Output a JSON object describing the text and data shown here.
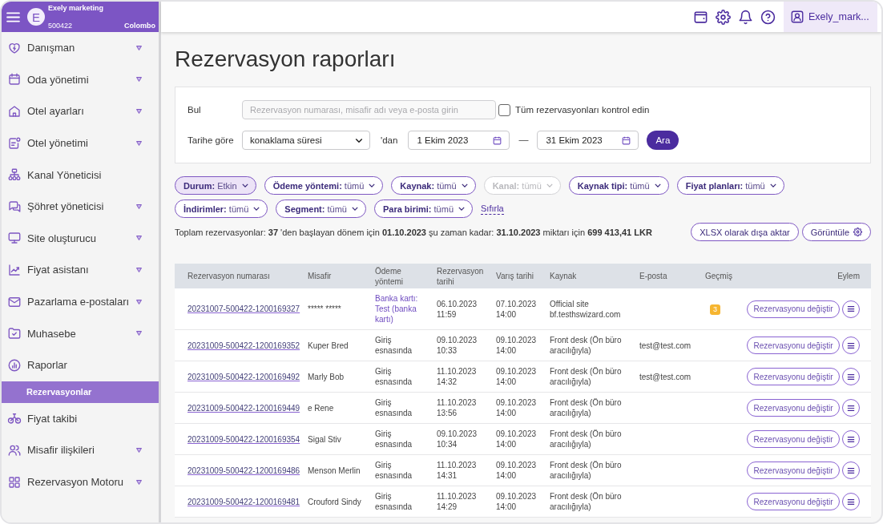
{
  "sidebar": {
    "header": {
      "avatar_letter": "E",
      "org_name": "Exely marketing",
      "org_id": "500422",
      "city": "Colombo"
    },
    "items": [
      {
        "label": "Danışman",
        "has_submenu": true,
        "selected": false
      },
      {
        "label": "Oda yönetimi",
        "has_submenu": true,
        "selected": false
      },
      {
        "label": "Otel ayarları",
        "has_submenu": true,
        "selected": false
      },
      {
        "label": "Otel yönetimi",
        "has_submenu": true,
        "selected": false
      },
      {
        "label": "Kanal Yöneticisi",
        "has_submenu": false,
        "selected": false
      },
      {
        "label": "Şöhret yöneticisi",
        "has_submenu": true,
        "selected": false
      },
      {
        "label": "Site oluşturucu",
        "has_submenu": true,
        "selected": false
      },
      {
        "label": "Fiyat asistanı",
        "has_submenu": true,
        "selected": false
      },
      {
        "label": "Pazarlama e-postaları",
        "has_submenu": true,
        "selected": false
      },
      {
        "label": "Muhasebe",
        "has_submenu": true,
        "selected": false
      },
      {
        "label": "Raporlar",
        "has_submenu": false,
        "selected": false,
        "children": [
          {
            "label": "Rezervasyonlar",
            "selected": true
          }
        ]
      },
      {
        "label": "Fiyat takibi",
        "has_submenu": false,
        "selected": false
      },
      {
        "label": "Misafir ilişkileri",
        "has_submenu": true,
        "selected": false
      },
      {
        "label": "Rezervasyon Motoru",
        "has_submenu": true,
        "selected": false
      }
    ]
  },
  "top_bar": {
    "user": "Exely_mark..."
  },
  "title": "Rezervasyon raporları",
  "search_panel": {
    "find_label": "Bul",
    "search": {
      "placeholder": "Rezervasyon numarası, misafir adı veya e-posta girin"
    },
    "check_all": {
      "label": "Tüm rezervasyonları kontrol edin",
      "checked": false
    },
    "date_label": "Tarihe göre",
    "date_type": "konaklama süresi",
    "from_suffix": "'dan",
    "date_from": "1 Ekim 2023",
    "range_dash": "—",
    "date_to": "31 Ekim 2023",
    "search_button": "Ara"
  },
  "filters": [
    {
      "label": "Durum:",
      "value": "Etkin",
      "selected": true,
      "disabled": false
    },
    {
      "label": "Ödeme yöntemi:",
      "value": "tümü",
      "selected": false,
      "disabled": false
    },
    {
      "label": "Kaynak:",
      "value": "tümü",
      "selected": false,
      "disabled": false
    },
    {
      "label": "Kanal:",
      "value": "tümü",
      "selected": false,
      "disabled": true
    },
    {
      "label": "Kaynak tipi:",
      "value": "tümü",
      "selected": false,
      "disabled": false
    },
    {
      "label": "Fiyat planları:",
      "value": "tümü",
      "selected": false,
      "disabled": false
    },
    {
      "label": "İndirimler:",
      "value": "tümü",
      "selected": false,
      "disabled": false
    },
    {
      "label": "Segment:",
      "value": "tümü",
      "selected": false,
      "disabled": false
    },
    {
      "label": "Para birimi:",
      "value": "tümü",
      "selected": false,
      "disabled": false
    }
  ],
  "reset_link": "Sıfırla",
  "summary": "Toplam rezervasyonlar: **37** 'den başlayan dönem için **01.10.2023** şu zaman kadar: **31.10.2023** miktarı için **699 413,41 LKR**",
  "export_button": "XLSX olarak dışa aktar",
  "view_button": "Görüntüle",
  "table": {
    "columns": [
      "Rezervasyon numarası",
      "Misafir",
      "Ödeme yöntemi",
      "Rezervasyon tarihi",
      "Varış tarihi",
      "Kaynak",
      "E-posta",
      "Geçmiş",
      "Eylem"
    ],
    "rows": [
      {
        "number": "20231007-500422-1200169327",
        "guest": "***** *****",
        "payment": "Banka kartı: Test (banka kartı)",
        "payment_link": true,
        "booked": "06.10.2023 11:59",
        "arrival": "07.10.2023 14:00",
        "source": "Official site bf.testhswizard.com",
        "history": "3",
        "action": "Rezervasyonu değiştir"
      },
      {
        "number": "20231009-500422-1200169352",
        "guest": "Kuper Bred",
        "payment": "Giriş esnasında",
        "payment_link": false,
        "booked": "09.10.2023 10:33",
        "arrival": "09.10.2023 14:00",
        "source": "Front desk (Ön büro aracılığıyla)",
        "email": "test@test.com",
        "action": "Rezervasyonu değiştir"
      },
      {
        "number": "20231009-500422-1200169492",
        "guest": "Marly Bob",
        "payment": "Giriş esnasında",
        "payment_link": false,
        "booked": "11.10.2023 14:32",
        "arrival": "09.10.2023 14:00",
        "source": "Front desk (Ön büro aracılığıyla)",
        "email": "test@test.com",
        "action": "Rezervasyonu değiştir"
      },
      {
        "number": "20231009-500422-1200169449",
        "guest": "e Rene",
        "payment": "Giriş esnasında",
        "payment_link": false,
        "booked": "11.10.2023 13:56",
        "arrival": "09.10.2023 14:00",
        "source": "Front desk (Ön büro aracılığıyla)",
        "action": "Rezervasyonu değiştir"
      },
      {
        "number": "20231009-500422-1200169354",
        "guest": "Sigal Stiv",
        "payment": "Giriş esnasında",
        "payment_link": false,
        "booked": "09.10.2023 10:34",
        "arrival": "09.10.2023 14:00",
        "source": "Front desk (Ön büro aracılığıyla)",
        "action": "Rezervasyonu değiştir"
      },
      {
        "number": "20231009-500422-1200169486",
        "guest": "Menson Merlin",
        "payment": "Giriş esnasında",
        "payment_link": false,
        "booked": "11.10.2023 14:31",
        "arrival": "09.10.2023 14:00",
        "source": "Front desk (Ön büro aracılığıyla)",
        "action": "Rezervasyonu değiştir"
      },
      {
        "number": "20231009-500422-1200169481",
        "guest": "Crouford Sindy",
        "payment": "Giriş esnasında",
        "payment_link": false,
        "booked": "11.10.2023 14:29",
        "arrival": "09.10.2023 14:00",
        "source": "Front desk (Ön büro aracılığıyla)",
        "action": "Rezervasyonu değiştir"
      }
    ]
  }
}
